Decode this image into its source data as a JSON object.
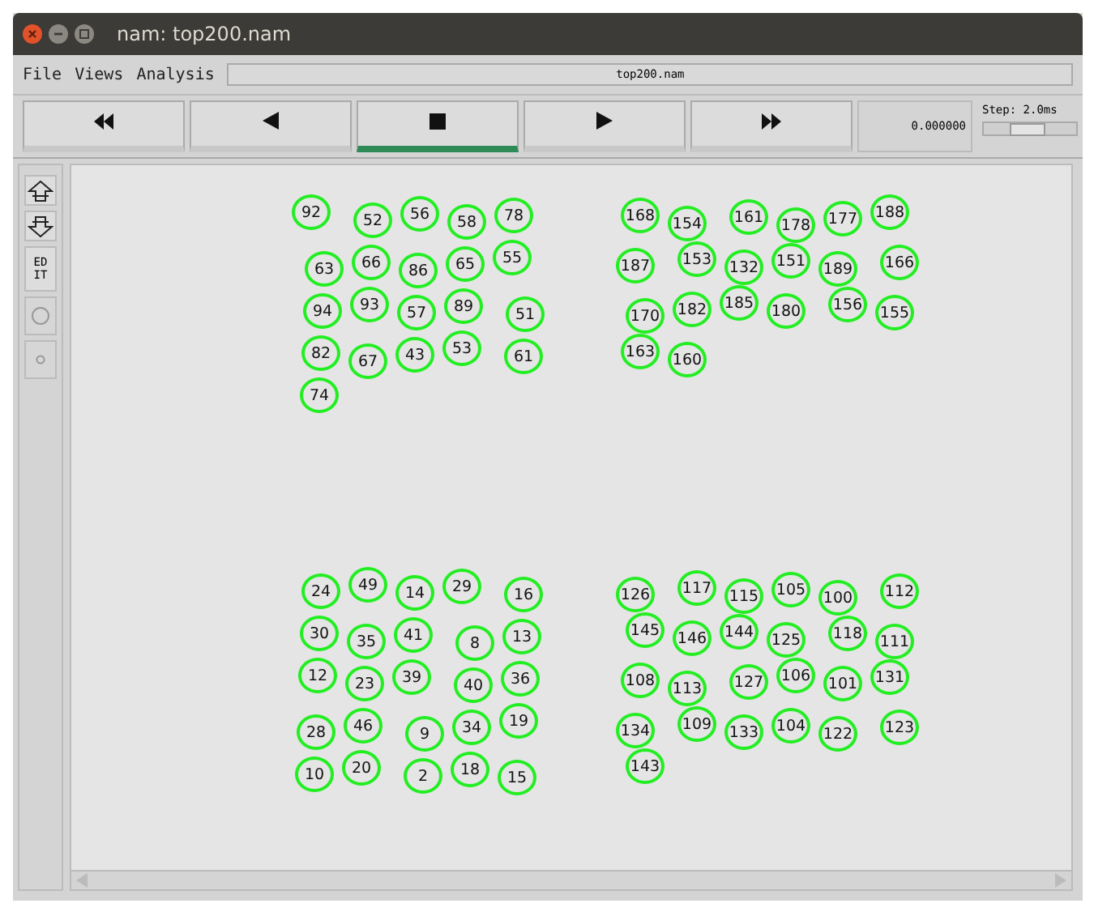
{
  "window": {
    "title": "nam: top200.nam"
  },
  "menu": [
    "File",
    "Views",
    "Analysis"
  ],
  "file_field": "top200.nam",
  "controls": [
    {
      "kind": "rewind",
      "selected": false
    },
    {
      "kind": "back",
      "selected": false
    },
    {
      "kind": "stop",
      "selected": true
    },
    {
      "kind": "play",
      "selected": false
    },
    {
      "kind": "forward",
      "selected": false
    }
  ],
  "time": "0.000000",
  "step": {
    "label": "Step: 2.0ms",
    "level": 0.45
  },
  "tools": [
    {
      "kind": "zoom-in"
    },
    {
      "kind": "zoom-out"
    },
    {
      "kind": "edit",
      "label": "EDIT"
    },
    {
      "kind": "large-circle"
    },
    {
      "kind": "small-circle"
    }
  ],
  "clusters": [
    {
      "nodes": [
        "92",
        "52",
        "56",
        "58",
        "78",
        "63",
        "66",
        "86",
        "65",
        "55",
        "94",
        "93",
        "57",
        "89",
        "51",
        "82",
        "67",
        "43",
        "53",
        "61",
        "74"
      ]
    },
    {
      "nodes": [
        "168",
        "154",
        "161",
        "178",
        "177",
        "188",
        "187",
        "153",
        "132",
        "151",
        "189",
        "166",
        "170",
        "182",
        "185",
        "180",
        "156",
        "155",
        "163",
        "160"
      ]
    },
    {
      "nodes": [
        "24",
        "49",
        "14",
        "29",
        "16",
        "30",
        "35",
        "41",
        "8",
        "13",
        "12",
        "23",
        "39",
        "40",
        "36",
        "28",
        "46",
        "9",
        "34",
        "19",
        "10",
        "20",
        "2",
        "18",
        "15"
      ]
    },
    {
      "nodes": [
        "126",
        "117",
        "115",
        "105",
        "100",
        "112",
        "145",
        "146",
        "144",
        "125",
        "118",
        "111",
        "108",
        "113",
        "127",
        "106",
        "101",
        "131",
        "134",
        "109",
        "133",
        "104",
        "122",
        "123",
        "143"
      ]
    }
  ]
}
